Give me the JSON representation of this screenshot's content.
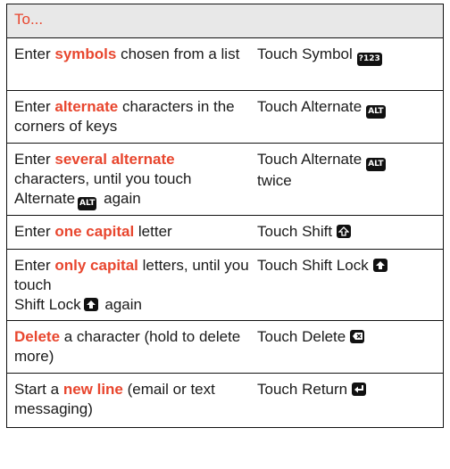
{
  "header": {
    "label": "To..."
  },
  "rows": [
    {
      "pre": "Enter ",
      "hl": "symbols",
      "post": " chosen from a list",
      "action": "Touch Symbol",
      "key": "?123"
    },
    {
      "pre": "Enter ",
      "hl": "alternate",
      "post": " characters in the corners of keys",
      "action": "Touch Alternate",
      "key": "ALT"
    },
    {
      "pre": "Enter ",
      "hl": "several alternate",
      "post": " characters, until you touch",
      "post2": "Alternate",
      "post2_key": "ALT",
      "post3": " again",
      "action": "Touch Alternate",
      "key": "ALT",
      "action2": "twice"
    },
    {
      "pre": "Enter ",
      "hl": "one capital",
      "post": " letter",
      "action": "Touch Shift",
      "key_icon": "shift-icon"
    },
    {
      "pre": "Enter ",
      "hl": "only capital",
      "post": " letters, until you touch",
      "post2": "Shift Lock",
      "post3": " again",
      "post2_key_icon": "shift-lock-icon",
      "action": "Touch Shift Lock",
      "key_icon": "shift-lock-icon"
    },
    {
      "pre": "",
      "hl": "Delete",
      "post": " a character (hold to delete more)",
      "action": "Touch Delete",
      "key_icon": "delete-icon"
    },
    {
      "pre": "Start a ",
      "hl": "new line",
      "post": " (email or text messaging)",
      "action": "Touch Return",
      "key_icon": "return-icon"
    }
  ],
  "colors": {
    "highlight": "#e8462e",
    "header_bg": "#e8e8e8",
    "key_bg": "#111111"
  }
}
